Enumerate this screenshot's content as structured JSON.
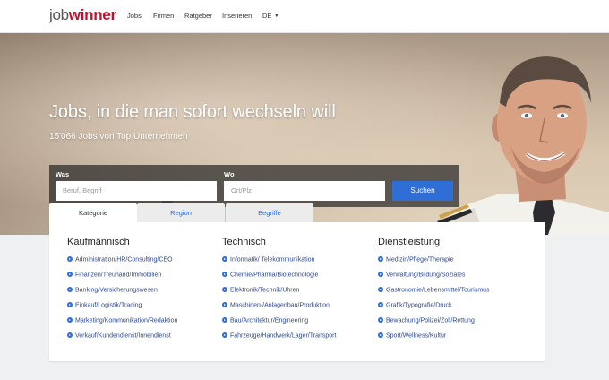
{
  "header": {
    "logo_part1": "job",
    "logo_part2": "winner",
    "nav": [
      "Jobs",
      "Firmen",
      "Ratgeber",
      "Inserieren",
      "DE"
    ]
  },
  "hero": {
    "headline": "Jobs, in die man sofort wechseln will",
    "subline": "15'066 Jobs von Top Unternehmen"
  },
  "search": {
    "was_label": "Was",
    "was_placeholder": "Beruf, Begriff",
    "wo_label": "Wo",
    "wo_placeholder": "Ort/Plz",
    "button": "Suchen"
  },
  "tabs": [
    "Kategorie",
    "Region",
    "Begriffe"
  ],
  "columns": [
    {
      "title": "Kaufmännisch",
      "items": [
        "Administration/HR/Consulting/CEO",
        "Finanzen/Treuhand/Immobilien",
        "Banking/Versicherungswesen",
        "Einkauf/Logistik/Trading",
        "Marketing/Kommunikation/Redaktion",
        "Verkauf/Kundendienst/Innendienst"
      ]
    },
    {
      "title": "Technisch",
      "items": [
        "Informatik/ Telekommunikation",
        "Chemie/Pharma/Biotechnologie",
        "Elektronik/Technik/Uhren",
        "Maschinen-/Anlagenbau/Produktion",
        "Bau/Architektur/Engineering",
        "Fahrzeuge/Handwerk/Lager/Transport"
      ]
    },
    {
      "title": "Dienstleistung",
      "items": [
        "Medizin/Pflege/Therapie",
        "Verwaltung/Bildung/Soziales",
        "Gastronomie/Lebensmittel/Tourismus",
        "Grafik/Typografie/Druck",
        "Bewachung/Polizei/Zoll/Rettung",
        "Sport/Wellness/Kultur"
      ]
    }
  ],
  "colors": {
    "brand_red": "#c8102e",
    "accent_blue": "#2f6fd5"
  }
}
